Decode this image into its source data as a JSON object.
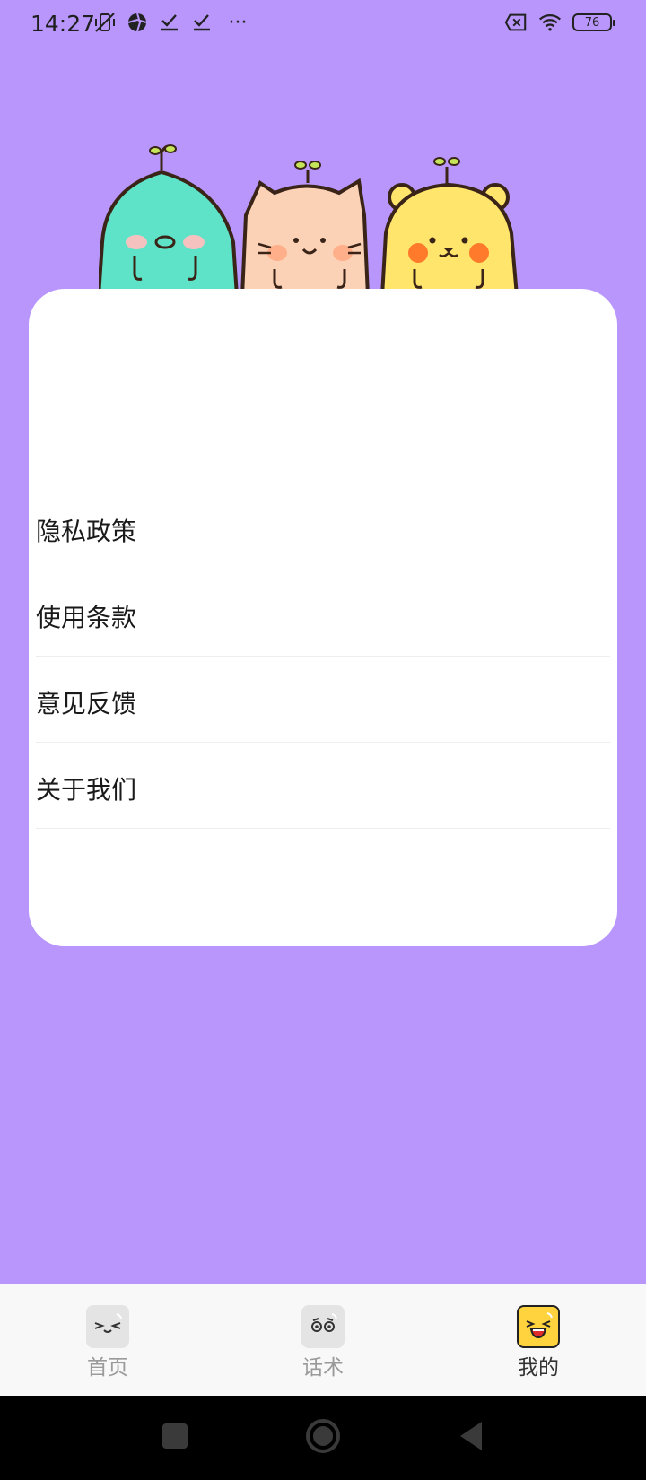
{
  "status_bar": {
    "time": "14:27",
    "left_icons": [
      "mute-vibrate-icon",
      "aperture-icon",
      "check-download-icon",
      "check-download-icon",
      "more-dots-icon"
    ],
    "more_label": "···",
    "right_icons": [
      "no-sim-icon",
      "wifi-icon"
    ],
    "battery": "76"
  },
  "mascots": [
    "green-fluffy-mascot",
    "peach-cat-mascot",
    "yellow-bear-mascot"
  ],
  "menu": {
    "items": [
      {
        "label": "隐私政策"
      },
      {
        "label": "使用条款"
      },
      {
        "label": "意见反馈"
      },
      {
        "label": "关于我们"
      }
    ]
  },
  "bottom_nav": {
    "items": [
      {
        "label": "首页",
        "icon": "squint-face-icon",
        "active": false
      },
      {
        "label": "话术",
        "icon": "dizzy-face-icon",
        "active": false
      },
      {
        "label": "我的",
        "icon": "laughing-face-icon",
        "active": true
      }
    ]
  },
  "colors": {
    "background": "#b896fb",
    "card": "#ffffff",
    "nav_bg": "#f8f8f8",
    "active_icon_bg": "#ffd33d"
  }
}
